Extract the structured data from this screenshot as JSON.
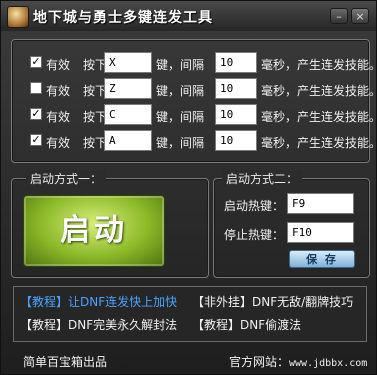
{
  "window": {
    "title": "地下城与勇士多键连发工具"
  },
  "rows": [
    {
      "checked": true,
      "enabled_label": "有效",
      "press_label": "按下",
      "key": "X",
      "sep_label": "键，间隔",
      "interval": "10",
      "suffix_label": "毫秒，产生连发技能。"
    },
    {
      "checked": false,
      "enabled_label": "有效",
      "press_label": "按下",
      "key": "Z",
      "sep_label": "键，间隔",
      "interval": "10",
      "suffix_label": "毫秒，产生连发技能。"
    },
    {
      "checked": true,
      "enabled_label": "有效",
      "press_label": "按下",
      "key": "C",
      "sep_label": "键，间隔",
      "interval": "10",
      "suffix_label": "毫秒，产生连发技能。"
    },
    {
      "checked": true,
      "enabled_label": "有效",
      "press_label": "按下",
      "key": "A",
      "sep_label": "键，间隔",
      "interval": "10",
      "suffix_label": "毫秒，产生连发技能。"
    }
  ],
  "method1": {
    "title": "启动方式一：",
    "start_label": "启动"
  },
  "method2": {
    "title": "启动方式二：",
    "start_hotkey_label": "启动热键：",
    "start_hotkey_value": "F9",
    "stop_hotkey_label": "停止热键：",
    "stop_hotkey_value": "F10",
    "save_label": "保 存"
  },
  "links": [
    {
      "text": "【教程】让DNF连发快上加快",
      "color": "blue"
    },
    {
      "text": "【非外挂】DNF无敌/翻牌技巧",
      "color": "white"
    },
    {
      "text": "【教程】DNF完美永久解封法",
      "color": "white"
    },
    {
      "text": "【教程】DNF偷渡法",
      "color": "white"
    }
  ],
  "footer": {
    "left": "简单百宝箱出品",
    "right_label": "官方网站：",
    "url": "www.jdbbx.com"
  },
  "colors": {
    "start_button": "#8cb828",
    "link_blue": "#4aa3ff",
    "save_button": "#7fb2d8"
  }
}
